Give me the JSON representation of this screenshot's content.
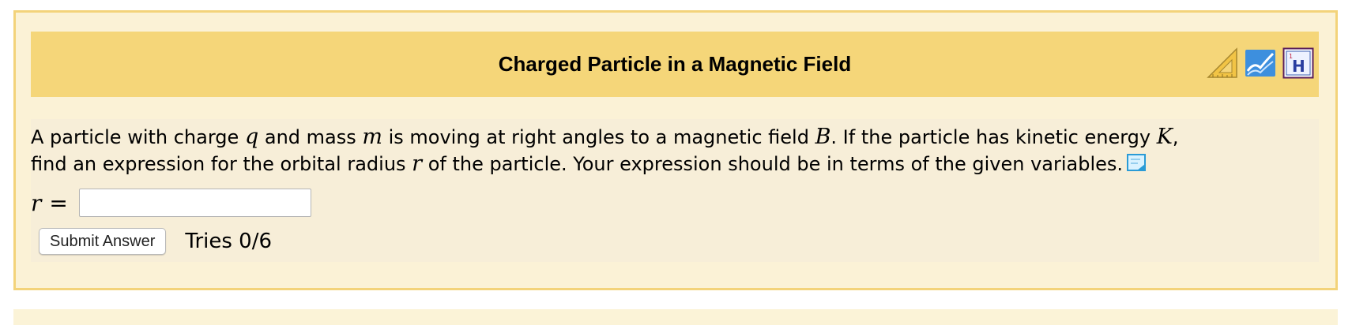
{
  "problem": {
    "title": "Charged Particle in a Magnetic Field",
    "tools": [
      {
        "icon": "ruler-triangle-icon",
        "tooltip": ""
      },
      {
        "icon": "book-icon",
        "tooltip": ""
      },
      {
        "icon": "hydrogen-element-icon",
        "tooltip": ""
      }
    ],
    "question": {
      "p1": "A particle with charge ",
      "v_q": "q",
      "p2": " and mass ",
      "v_m": "m",
      "p3": " is moving at right angles to a magnetic field ",
      "v_B": "B",
      "p4": ". If the particle has kinetic energy ",
      "v_K": "K",
      "p5": ",",
      "p6": "find an expression for the orbital radius ",
      "v_r": "r",
      "p7": " of the particle. Your expression should be in terms of the given variables."
    },
    "answer": {
      "variable": "r",
      "equals": "=",
      "value": "",
      "placeholder": ""
    },
    "submit_label": "Submit Answer",
    "tries_text": "Tries 0/6"
  },
  "colors": {
    "panel_bg": "#fbf2d6",
    "panel_border": "#f3d37a",
    "header_bg": "#f5d679",
    "body_bg": "#f7eed8"
  }
}
